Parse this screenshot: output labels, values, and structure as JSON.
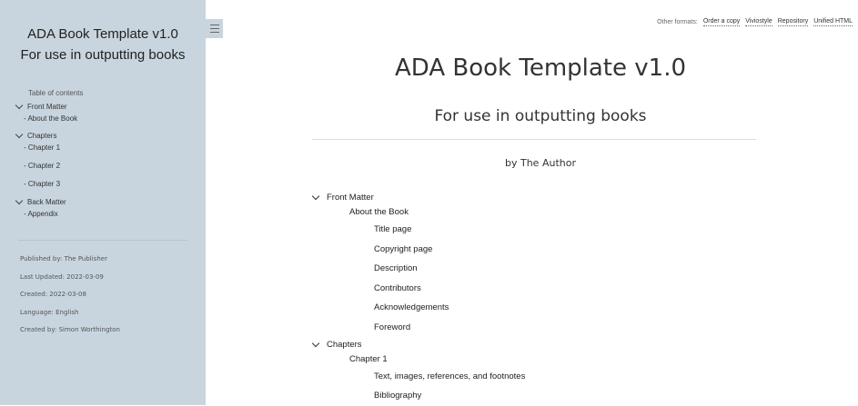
{
  "sidebar": {
    "title_line1": "ADA Book Template v1.0",
    "title_line2": "For use in outputting books",
    "toc_heading": "Table of contents",
    "front_matter": {
      "label": "Front Matter",
      "items": [
        "- About the Book"
      ]
    },
    "chapters": {
      "label": "Chapters",
      "items": [
        "- Chapter 1",
        "- Chapter 2",
        "- Chapter 3"
      ]
    },
    "back_matter": {
      "label": "Back Matter",
      "items": [
        "- Appendix"
      ]
    },
    "meta": [
      "Published by: The Publisher",
      "Last Updated: 2022-03-09",
      "Created: 2022-03-08",
      "Language: English",
      "Created by: Simon Worthington"
    ]
  },
  "formats": {
    "label": "Other formats:",
    "links": [
      "Order a copy",
      "Viviostyle",
      "Repository",
      "Unified HTML"
    ]
  },
  "main": {
    "title": "ADA Book Template v1.0",
    "subtitle": "For use in outputting books",
    "byline": "by The Author",
    "front_matter": {
      "label": "Front Matter",
      "sub": "About the Book",
      "items": [
        "Title page",
        "Copyright page",
        "Description",
        "Contributors",
        "Acknowledgements",
        "Foreword"
      ]
    },
    "chapters": {
      "label": "Chapters",
      "sub": "Chapter 1",
      "items": [
        "Text, images, references, and footnotes",
        "Bibliography"
      ]
    }
  }
}
